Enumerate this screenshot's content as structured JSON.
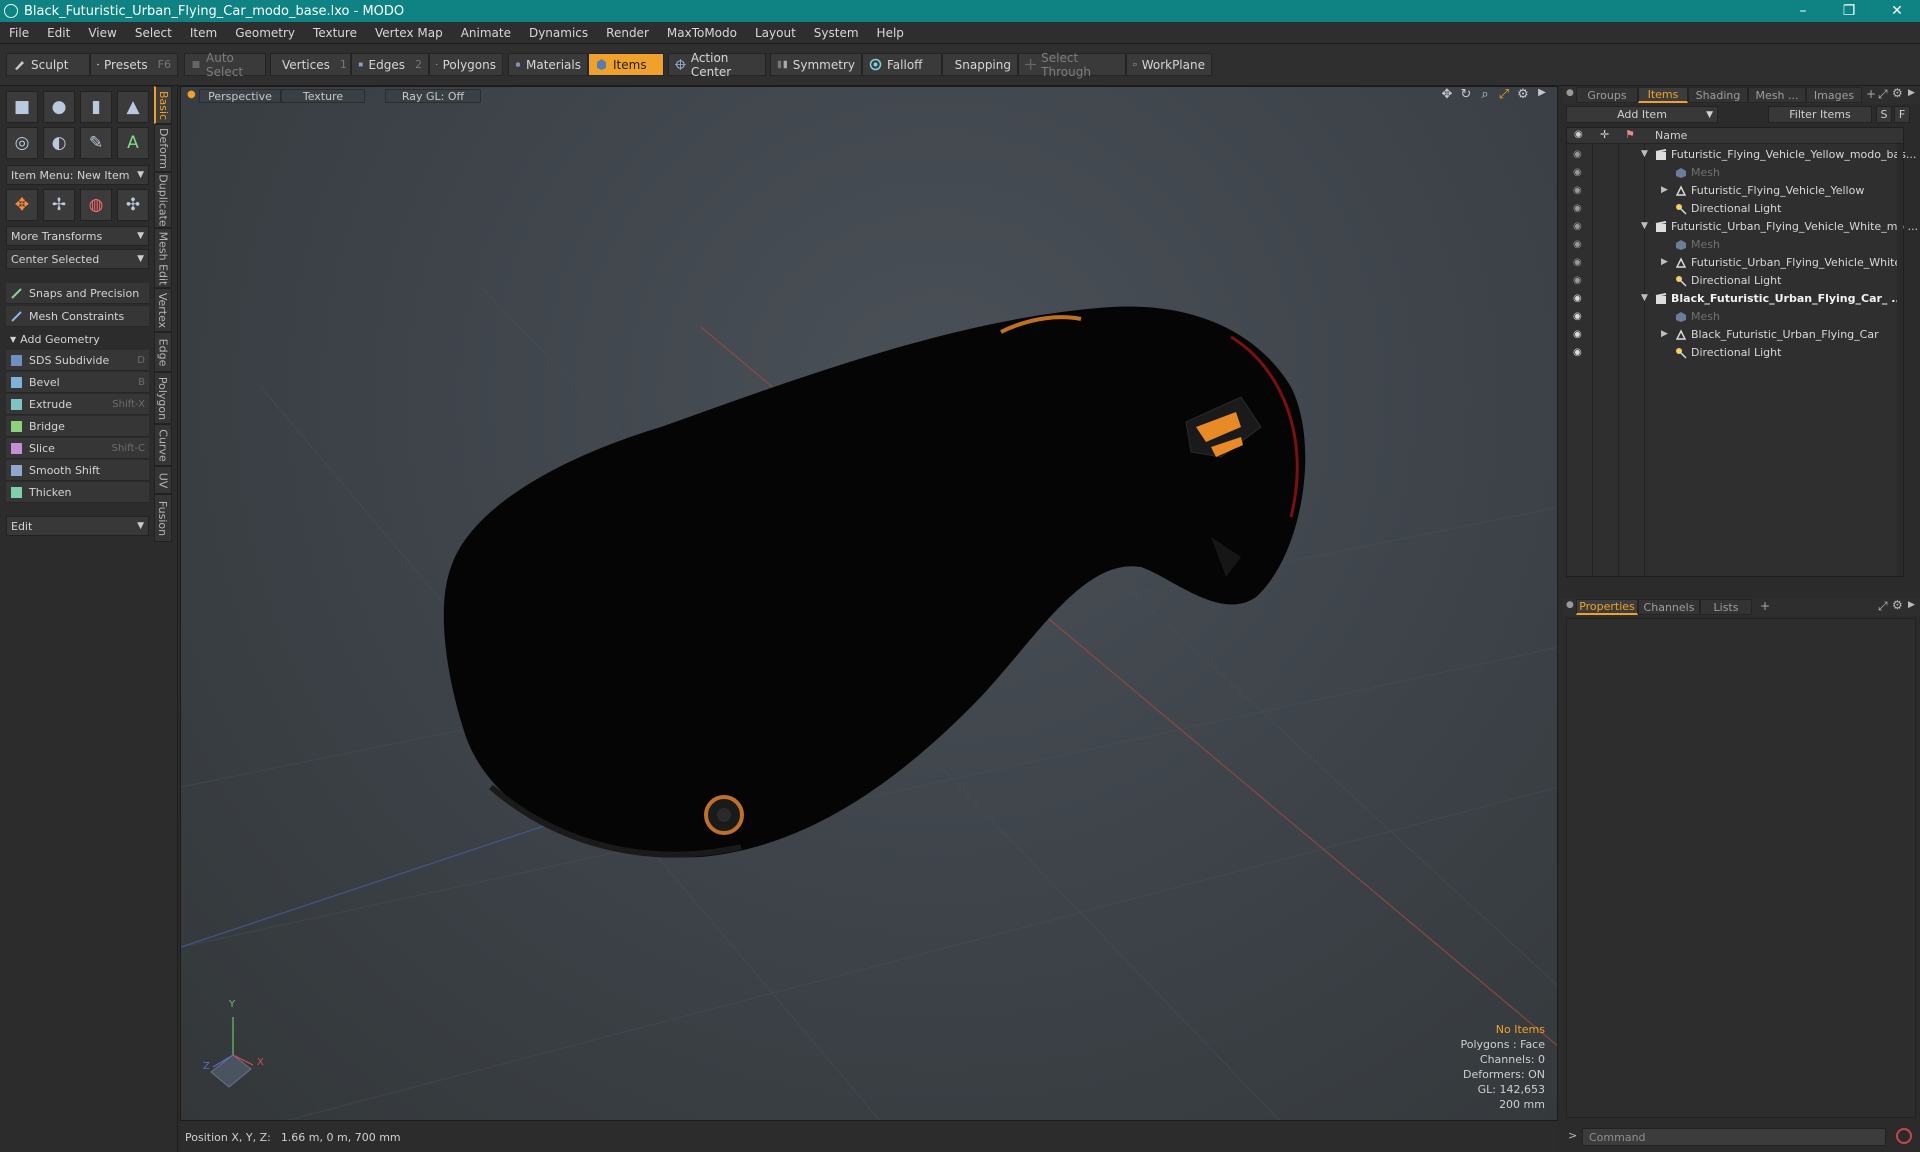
{
  "window": {
    "title": "Black_Futuristic_Urban_Flying_Car_modo_base.lxo - MODO",
    "minimize": "–",
    "maximize": "❐",
    "close": "✕"
  },
  "menu": [
    "File",
    "Edit",
    "View",
    "Select",
    "Item",
    "Geometry",
    "Texture",
    "Vertex Map",
    "Animate",
    "Dynamics",
    "Render",
    "MaxToModo",
    "Layout",
    "System",
    "Help"
  ],
  "toolbar": {
    "sculpt": "Sculpt",
    "presets": "Presets",
    "presets_shortcut": "F6",
    "auto_select": "Auto Select",
    "vertices": "Vertices",
    "vertices_shortcut": "1",
    "edges": "Edges",
    "edges_shortcut": "2",
    "polygons": "Polygons",
    "materials": "Materials",
    "items": "Items",
    "action_center": "Action Center",
    "symmetry": "Symmetry",
    "falloff": "Falloff",
    "snapping": "Snapping",
    "select_through": "Select Through",
    "workplane": "WorkPlane"
  },
  "left_panel": {
    "item_menu": "Item Menu: New Item",
    "more_transforms": "More Transforms",
    "center_selected": "Center Selected",
    "snaps": "Snaps and Precision",
    "mesh_constraints": "Mesh Constraints",
    "add_geometry": "Add Geometry",
    "tools": [
      {
        "label": "SDS Subdivide",
        "shortcut": "D"
      },
      {
        "label": "Bevel",
        "shortcut": "B"
      },
      {
        "label": "Extrude",
        "shortcut": "Shift-X"
      },
      {
        "label": "Bridge",
        "shortcut": ""
      },
      {
        "label": "Slice",
        "shortcut": "Shift-C"
      },
      {
        "label": "Smooth Shift",
        "shortcut": ""
      },
      {
        "label": "Thicken",
        "shortcut": ""
      }
    ],
    "edit_dropdown": "Edit"
  },
  "vertical_tabs": [
    "Basic",
    "Deform",
    "Duplicate",
    "Mesh Edit",
    "Vertex",
    "Edge",
    "Polygon",
    "Curve",
    "UV",
    "Fusion"
  ],
  "viewport": {
    "view_mode": "Perspective",
    "shading": "Texture",
    "ray_gl": "Ray GL: Off",
    "info": {
      "selection": "No Items",
      "polygons": "Polygons : Face",
      "channels": "Channels: 0",
      "deformers": "Deformers: ON",
      "gl": "GL: 142,653",
      "scale": "200 mm"
    },
    "axis_y": "Y",
    "axis_x": "X",
    "axis_z": "Z"
  },
  "status": {
    "label": "Position X, Y, Z:",
    "value": "1.66 m, 0 m, 700 mm"
  },
  "right_panel": {
    "tabs": [
      "Groups",
      "Items",
      "Shading",
      "Mesh ...",
      "Images"
    ],
    "add_item": "Add Item",
    "filter_items": "Filter Items",
    "filter_s": "S",
    "filter_f": "F",
    "name_col": "Name",
    "tree": [
      {
        "label": "Futuristic_Flying_Vehicle_Yellow_modo_bas...",
        "type": "scene",
        "level": 0
      },
      {
        "label": "Mesh",
        "type": "mesh",
        "level": 1
      },
      {
        "label": "Futuristic_Flying_Vehicle_Yellow",
        "type": "group",
        "level": 1
      },
      {
        "label": "Directional Light",
        "type": "light",
        "level": 1
      },
      {
        "label": "Futuristic_Urban_Flying_Vehicle_White_mo ...",
        "type": "scene",
        "level": 0
      },
      {
        "label": "Mesh",
        "type": "mesh",
        "level": 1
      },
      {
        "label": "Futuristic_Urban_Flying_Vehicle_White",
        "type": "group",
        "level": 1
      },
      {
        "label": "Directional Light",
        "type": "light",
        "level": 1
      },
      {
        "label": "Black_Futuristic_Urban_Flying_Car_ ...",
        "type": "scene",
        "level": 0
      },
      {
        "label": "Mesh",
        "type": "mesh",
        "level": 1
      },
      {
        "label": "Black_Futuristic_Urban_Flying_Car",
        "type": "group",
        "level": 1
      },
      {
        "label": "Directional Light",
        "type": "light",
        "level": 1
      }
    ],
    "props_tabs": [
      "Properties",
      "Channels",
      "Lists"
    ],
    "command_placeholder": "Command"
  }
}
